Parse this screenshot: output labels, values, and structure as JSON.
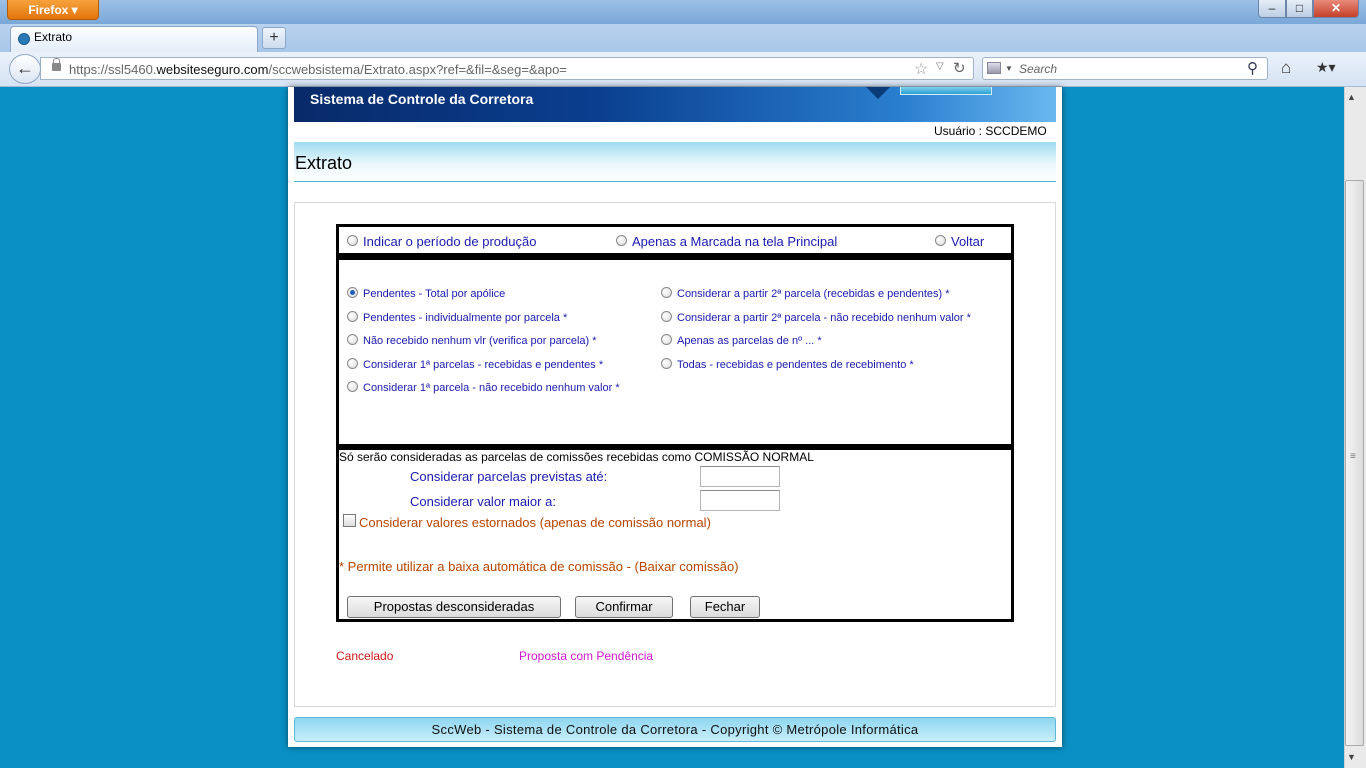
{
  "browser": {
    "menu_button": "Firefox",
    "tab_title": "Extrato",
    "url_prefix": "https://ssl5460.",
    "url_domain": "websiteseguro.com",
    "url_path": "/sccwebsistema/Extrato.aspx?ref=&fil=&seg=&apo=",
    "search_placeholder": "Search"
  },
  "header": {
    "banner_title": "Sistema de Controle da Corretora",
    "user": "Usuário : SCCDEMO",
    "page_title": "Extrato"
  },
  "top_options": [
    {
      "label": "Indicar o período de produção",
      "checked": false
    },
    {
      "label": "Apenas a Marcada na tela Principal",
      "checked": false
    },
    {
      "label": "Voltar",
      "checked": false
    }
  ],
  "left_options": [
    {
      "label": "Pendentes - Total por apólice",
      "checked": true
    },
    {
      "label": "Pendentes - individualmente por parcela *",
      "checked": false
    },
    {
      "label": "Não recebido nenhum vlr (verifica por parcela) *",
      "checked": false
    },
    {
      "label": "Considerar 1ª parcelas - recebidas e pendentes *",
      "checked": false
    },
    {
      "label": "Considerar 1ª parcela - não recebido nenhum valor *",
      "checked": false
    }
  ],
  "right_options": [
    {
      "label": "Considerar a partir 2ª parcela (recebidas e pendentes) *",
      "checked": false
    },
    {
      "label": "Considerar a partir 2ª parcela - não recebido nenhum valor *",
      "checked": false
    },
    {
      "label": "Apenas as parcelas de nº ... *",
      "checked": false
    },
    {
      "label": "Todas - recebidas e pendentes de recebimento *",
      "checked": false
    }
  ],
  "filters": {
    "notice": "Só serão consideradas as parcelas de comissões recebidas como COMISSÃO NORMAL",
    "parcelas_label": "Considerar parcelas previstas até:",
    "parcelas_value": "",
    "valor_label": "Considerar valor maior a:",
    "valor_value": "",
    "estorno_label": "Considerar valores estornados (apenas de comissão normal)",
    "baixa_note": "* Permite utilizar a baixa automática de comissão - (Baixar comissão)"
  },
  "buttons": {
    "propostas": "Propostas desconsideradas",
    "confirmar": "Confirmar",
    "fechar": "Fechar"
  },
  "legend": {
    "cancelado": "Cancelado",
    "pendencia": "Proposta com Pendência"
  },
  "footer": "SccWeb - Sistema de Controle da Corretora - Copyright © Metrópole Informática",
  "colors": {
    "background": "#0a90c4",
    "option_text": "#1a1ab0",
    "warning_text": "#b84400",
    "cancelado": "#d01818",
    "pendencia": "#d018d0"
  }
}
